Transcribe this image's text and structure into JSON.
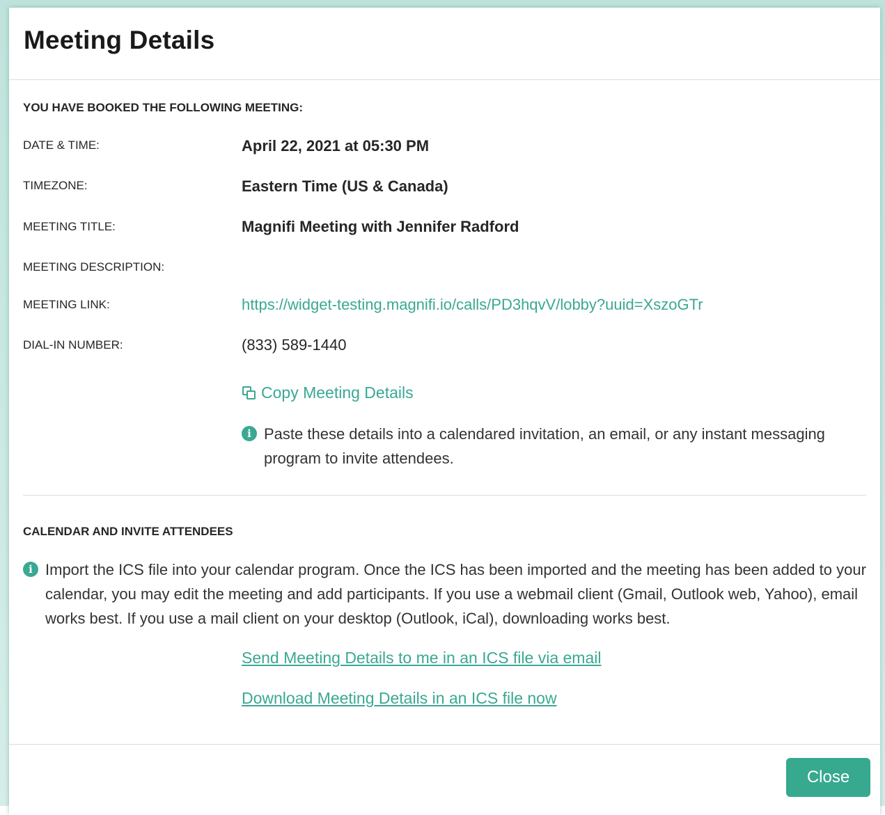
{
  "modal": {
    "title": "Meeting Details"
  },
  "booked": {
    "heading": "YOU HAVE BOOKED THE FOLLOWING MEETING:",
    "rows": [
      {
        "label": "DATE & TIME:",
        "value": "April 22, 2021 at 05:30 PM"
      },
      {
        "label": "TIMEZONE:",
        "value": "Eastern Time (US & Canada)"
      },
      {
        "label": "MEETING TITLE:",
        "value": "Magnifi Meeting with Jennifer Radford"
      },
      {
        "label": "MEETING DESCRIPTION:",
        "value": ""
      },
      {
        "label": "MEETING LINK:",
        "value": "https://widget-testing.magnifi.io/calls/PD3hqvV/lobby?uuid=XszoGTr"
      },
      {
        "label": "DIAL-IN NUMBER:",
        "value": "(833) 589-1440"
      }
    ],
    "copy_label": "Copy Meeting Details",
    "copy_hint": "Paste these details into a calendared invitation, an email, or any instant messaging program to invite attendees."
  },
  "calendar": {
    "heading": "CALENDAR AND INVITE ATTENDEES",
    "info": "Import the ICS file into your calendar program. Once the ICS has been imported and the meeting has been added to your calendar, you may edit the meeting and add participants. If you use a webmail client (Gmail, Outlook web, Yahoo), email works best. If you use a mail client on your desktop (Outlook, iCal), downloading works best.",
    "send_link": "Send Meeting Details to me in an ICS file via email",
    "download_link": "Download Meeting Details in an ICS file now"
  },
  "footer": {
    "close_label": "Close"
  },
  "colors": {
    "accent": "#3aa893",
    "button": "#36a98f",
    "backdrop": "#bfe3dc"
  },
  "icons": {
    "copy": "copy-icon",
    "info": "info-icon"
  }
}
